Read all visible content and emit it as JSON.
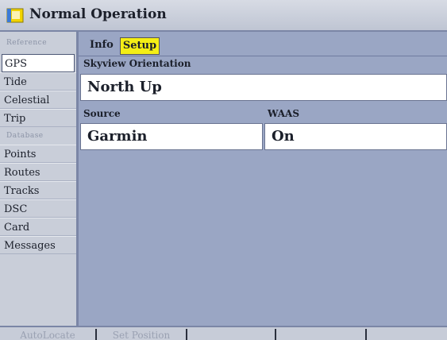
{
  "window": {
    "title": "Normal Operation"
  },
  "sidebar": {
    "sections": [
      {
        "heading": "Reference",
        "items": [
          "GPS",
          "Tide",
          "Celestial",
          "Trip"
        ]
      },
      {
        "heading": "Database",
        "items": [
          "Points",
          "Routes",
          "Tracks",
          "DSC",
          "Card",
          "Messages"
        ]
      }
    ],
    "selected": "GPS"
  },
  "tabs": [
    {
      "label": "Info",
      "active": false
    },
    {
      "label": "Setup",
      "active": true
    }
  ],
  "setup": {
    "skyview_orientation_label": "Skyview Orientation",
    "skyview_orientation_value": "North Up",
    "source_label": "Source",
    "source_value": "Garmin",
    "waas_label": "WAAS",
    "waas_value": "On"
  },
  "softkeys": [
    "AutoLocate",
    "Set Position",
    "",
    "",
    ""
  ],
  "colors": {
    "accent_tab": "#f4ee15",
    "panel": "#9aa6c4",
    "sidebar": "#c9ced9"
  }
}
